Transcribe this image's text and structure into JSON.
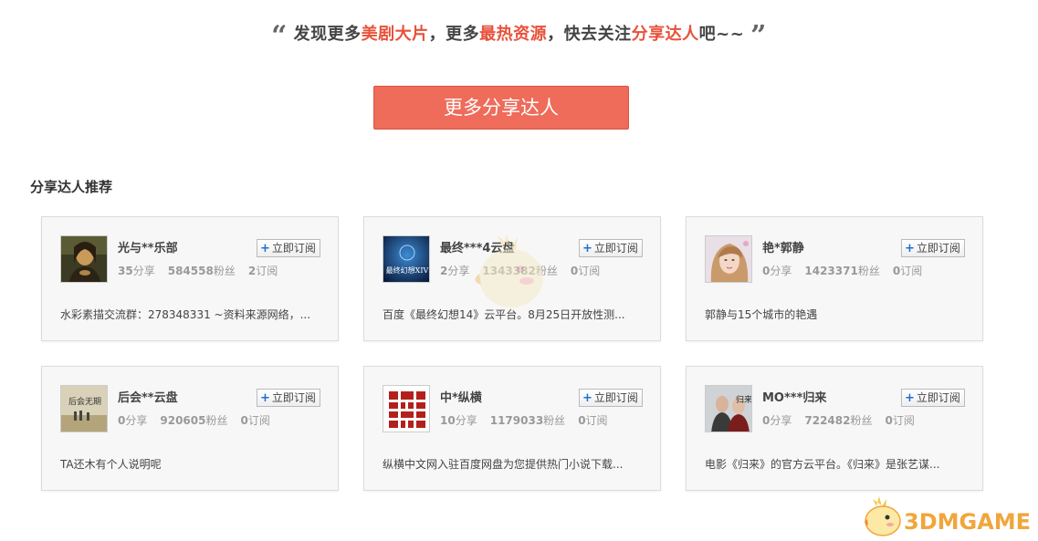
{
  "slogan": {
    "open_quote": "“",
    "part1": "发现更多",
    "hl1": "美剧大片",
    "part2": "，更多",
    "hl2": "最热资源",
    "part3": "，快去关注",
    "hl3": "分享达人",
    "part4": "吧~~",
    "close_quote": "”"
  },
  "cta_label": "更多分享达人",
  "section_title": "分享达人推荐",
  "subscribe_label": "立即订阅",
  "units": {
    "share": "分享",
    "fans": "粉丝",
    "sub": "订阅"
  },
  "cards": [
    {
      "name": "光与**乐部",
      "shares": "35",
      "fans": "584558",
      "subs": "2",
      "desc": "水彩素描交流群：278348331 ~资料来源网络，...",
      "avatar": "mona-lisa"
    },
    {
      "name": "最终***4云盘",
      "shares": "2",
      "fans": "1343382",
      "subs": "0",
      "desc": "百度《最终幻想14》云平台。8月25日开放性测...",
      "avatar": "final-fantasy-xiv",
      "avatar_text": "最终幻想XIV"
    },
    {
      "name": "艳*郭静",
      "shares": "0",
      "fans": "1423371",
      "subs": "0",
      "desc": "郭静与15个城市的艳遇",
      "avatar": "singer-portrait"
    },
    {
      "name": "后会**云盘",
      "shares": "0",
      "fans": "920605",
      "subs": "0",
      "desc": "TA还木有个人说明呢",
      "avatar": "movie-poster",
      "avatar_text": "后会无期"
    },
    {
      "name": "中*纵横",
      "shares": "10",
      "fans": "1179033",
      "subs": "0",
      "desc": "纵横中文网入驻百度网盘为您提供热门小说下载...",
      "avatar": "zongheng-logo"
    },
    {
      "name": "MO***归来",
      "shares": "0",
      "fans": "722482",
      "subs": "0",
      "desc": "电影《归来》的官方云平台。《归来》是张艺谋...",
      "avatar": "coming-home-poster",
      "avatar_text": "归来"
    }
  ],
  "watermark": {
    "text": "3DMGAME"
  },
  "colors": {
    "accent": "#e8513a",
    "button": "#ef6b5a",
    "subscribe_plus": "#1f6fd1",
    "watermark": "#f0a63b"
  }
}
